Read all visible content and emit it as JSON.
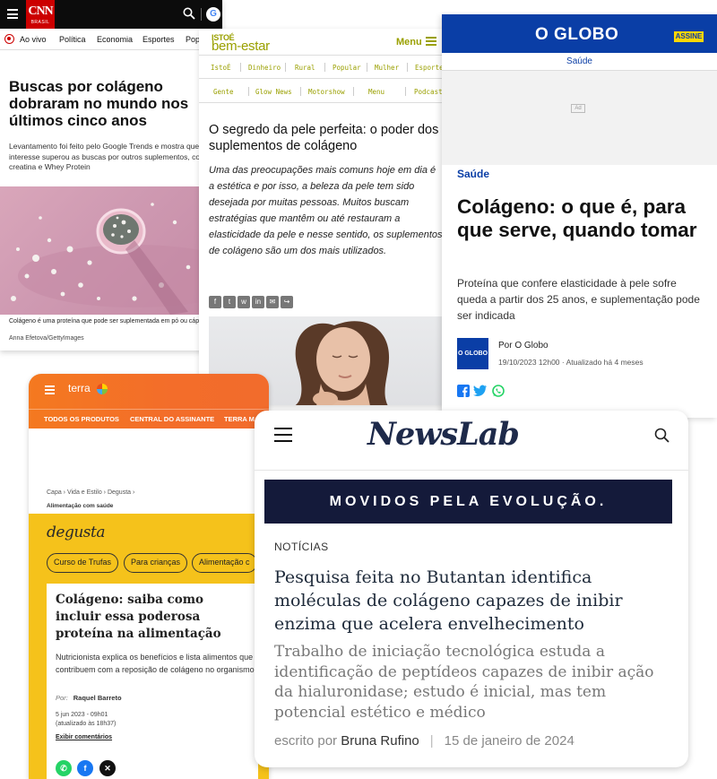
{
  "cnn": {
    "logo": "CNN",
    "logo_sub": "BRASIL",
    "nav": [
      "Ao vivo",
      "Política",
      "Economia",
      "Esportes",
      "Pop"
    ],
    "title": "Buscas por colágeno dobraram no mundo nos últimos cinco anos",
    "lead": "Levantamento foi feito pelo Google Trends e mostra que interesse superou as buscas por outros suplementos, como creatina e Whey Protein",
    "caption": "Colágeno é uma proteína que pode ser suplementada em pó ou cápsulas",
    "credit": "Anna Efetova/GettyImages"
  },
  "istoe": {
    "brand_top": "ISTOÉ",
    "brand": "bem-estar",
    "menu": "Menu",
    "row1": [
      "IstoÉ",
      "Dinheiro",
      "Rural",
      "Popular",
      "Mulher",
      "Esporte"
    ],
    "row2": [
      "Gente",
      "Glow News",
      "Motorshow",
      "Menu",
      "Podcast"
    ],
    "title": "O segredo da pele perfeita: o poder dos suplementos de colágeno",
    "body": "Uma das preocupações mais comuns hoje em dia é a estética e por isso, a beleza da pele tem sido desejada por muitas pessoas. Muitos buscam estratégias que mantêm ou até restauram a elasticidade da pele e nesse sentido, os suplementos de colágeno são um dos mais utilizados."
  },
  "globo": {
    "name": "O GLOBO",
    "assine": "ASSINE",
    "section": "Saúde",
    "ad": "Ad",
    "kicker": "Saúde",
    "title": "Colágeno: o que é, para que serve, quando tomar",
    "lead": "Proteína que confere elasticidade à pele sofre queda a partir dos 25 anos, e suplementação pode ser indicada",
    "avatar": "O GLOBO",
    "author": "Por O Globo",
    "date": "19/10/2023 12h00 · Atualizado há 4 meses"
  },
  "terra": {
    "logo": "terra",
    "nav": [
      "TODOS OS PRODUTOS",
      "CENTRAL DO ASSINANTE",
      "TERRA MA"
    ],
    "breadcrumb": "Capa  ›  Vida e Estilo  ›  Degusta  ›",
    "breadcrumb2": "Alimentação com saúde",
    "degusta": "degusta",
    "pills": [
      "Curso de Trufas",
      "Para crianças",
      "Alimentação c"
    ],
    "title": "Colágeno: saiba como incluir essa poderosa proteína na alimentação",
    "lead": "Nutricionista explica os benefícios e lista alimentos que contribuem com a reposição de colágeno no organismo",
    "by_label": "Por:",
    "author": "Raquel Barreto",
    "date": "5 jun 2023 - 09h01",
    "updated": "(atualizado às 18h37)",
    "comments": "Exibir comentários"
  },
  "newslab": {
    "brand": "NewsLab",
    "banner": "MOVIDOS PELA EVOLUÇÃO.",
    "label": "NOTÍCIAS",
    "title": "Pesquisa feita no Butantan identifica moléculas de colágeno capazes de inibir enzima que acelera envelhecimento",
    "subtitle": "Trabalho de iniciação tecnológica estuda a identificação de peptídeos capazes de inibir ação da hialuronidase; estudo é inicial, mas tem potencial estético e médico",
    "byline_prefix": "escrito por",
    "author": "Bruna Rufino",
    "date": "15 de janeiro de 2024"
  },
  "colors": {
    "cnn_red": "#cc0000",
    "istoe_olive": "#9aa000",
    "globo_blue": "#0a3ea6",
    "terra_orange": "#f47920",
    "degusta_yellow": "#f5c21b",
    "newslab_navy": "#141a3a"
  }
}
